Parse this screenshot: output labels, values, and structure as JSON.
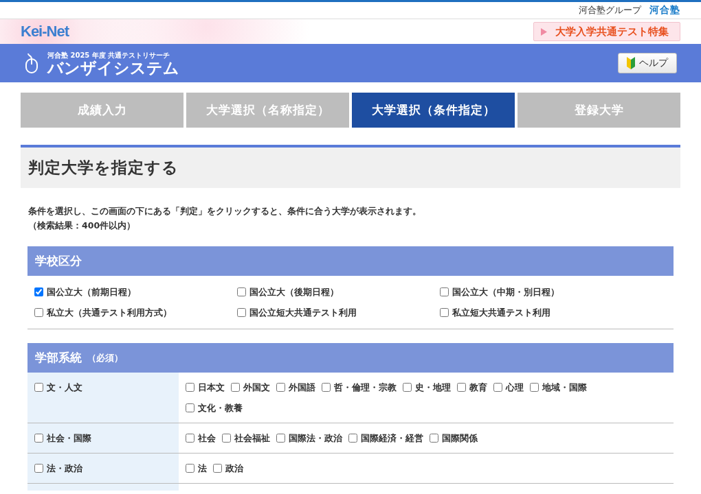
{
  "header": {
    "group_label": "河合塾グループ",
    "group_logo": "河合塾"
  },
  "kei_net": {
    "logo": "Kei-Net",
    "feature_link": "大学入学共通テスト特集"
  },
  "app_bar": {
    "subtitle": "河合塾 2025 年度 共通テストリサーチ",
    "title": "バンザイシステム",
    "help_button": "ヘルプ"
  },
  "tabs": [
    {
      "label": "成績入力",
      "selected": false
    },
    {
      "label": "大学選択（名称指定）",
      "selected": false
    },
    {
      "label": "大学選択（条件指定）",
      "selected": true
    },
    {
      "label": "登録大学",
      "selected": false
    }
  ],
  "page_title": "判定大学を指定する",
  "instructions": [
    "条件を選択し、この画面の下にある「判定」をクリックすると、条件に合う大学が表示されます。",
    "（検索結果：400件以内）"
  ],
  "school_type": {
    "heading": "学校区分",
    "options": [
      {
        "label": "国公立大（前期日程）",
        "checked": true
      },
      {
        "label": "国公立大（後期日程）",
        "checked": false
      },
      {
        "label": "国公立大（中期・別日程）",
        "checked": false
      },
      {
        "label": "私立大（共通テスト利用方式）",
        "checked": false
      },
      {
        "label": "国公立短大共通テスト利用",
        "checked": false
      },
      {
        "label": "私立短大共通テスト利用",
        "checked": false
      }
    ]
  },
  "faculty": {
    "heading": "学部系統",
    "required": "（必須）",
    "rows": [
      {
        "label": "文・人文",
        "checked": false,
        "options": [
          {
            "label": "日本文",
            "checked": false
          },
          {
            "label": "外国文",
            "checked": false
          },
          {
            "label": "外国語",
            "checked": false
          },
          {
            "label": "哲・倫理・宗教",
            "checked": false
          },
          {
            "label": "史・地理",
            "checked": false
          },
          {
            "label": "教育",
            "checked": false
          },
          {
            "label": "心理",
            "checked": false
          },
          {
            "label": "地域・国際",
            "checked": false
          },
          {
            "label": "文化・教養",
            "checked": false
          }
        ]
      },
      {
        "label": "社会・国際",
        "checked": false,
        "options": [
          {
            "label": "社会",
            "checked": false
          },
          {
            "label": "社会福祉",
            "checked": false
          },
          {
            "label": "国際法・政治",
            "checked": false
          },
          {
            "label": "国際経済・経営",
            "checked": false
          },
          {
            "label": "国際関係",
            "checked": false
          }
        ]
      },
      {
        "label": "法・政治",
        "checked": false,
        "options": [
          {
            "label": "法",
            "checked": false
          },
          {
            "label": "政治",
            "checked": false
          }
        ]
      }
    ]
  }
}
